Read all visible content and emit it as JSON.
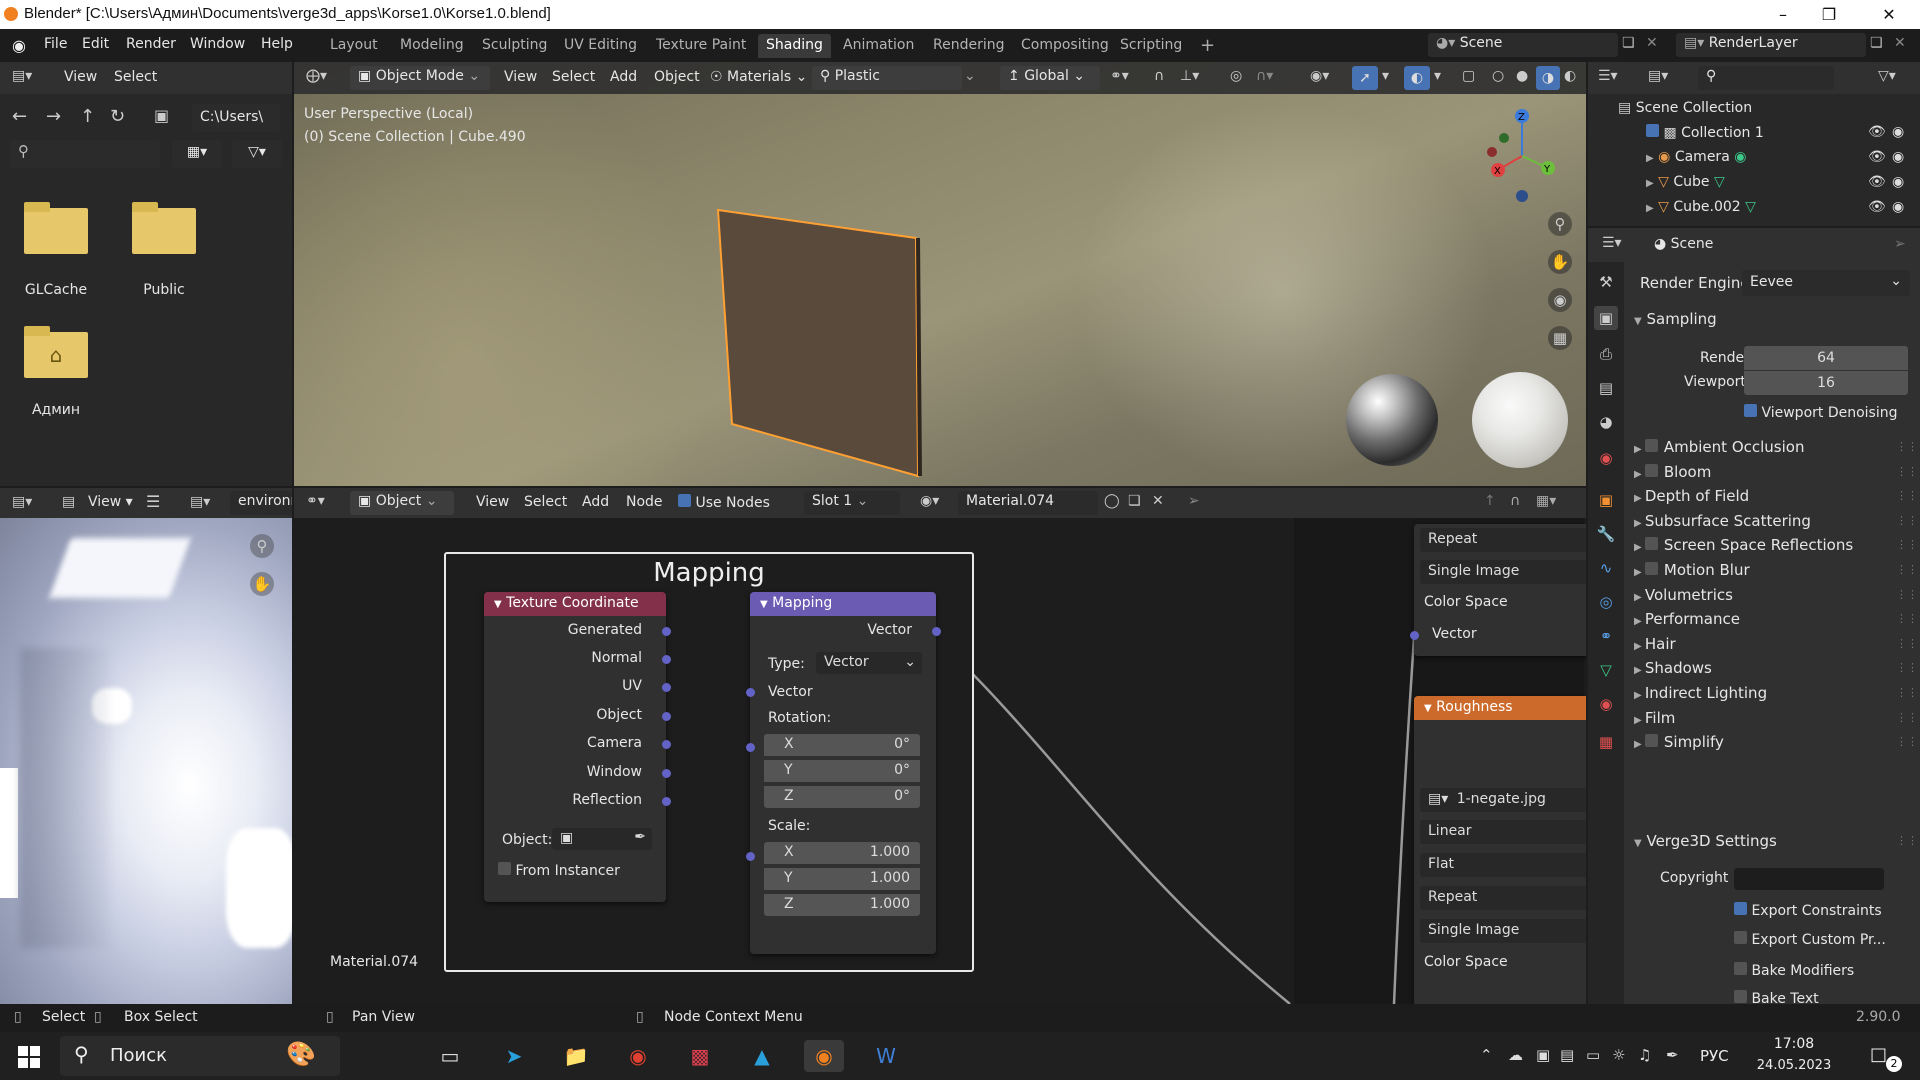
{
  "window": {
    "title": "Blender* [C:\\Users\\Админ\\Documents\\verge3d_apps\\Korse1.0\\Korse1.0.blend]"
  },
  "menu": [
    "File",
    "Edit",
    "Render",
    "Window",
    "Help"
  ],
  "workspaces": [
    "Layout",
    "Modeling",
    "Sculpting",
    "UV Editing",
    "Texture Paint",
    "Shading",
    "Animation",
    "Rendering",
    "Compositing",
    "Scripting"
  ],
  "active_workspace": "Shading",
  "scene": {
    "label": "Scene",
    "view_layer": "RenderLayer"
  },
  "filebrowser": {
    "menu": [
      "View",
      "Select"
    ],
    "path": "C:\\Users\\",
    "items": [
      {
        "label": "GLCache",
        "icon": "folder-icon"
      },
      {
        "label": "Public",
        "icon": "folder-icon"
      },
      {
        "label": "Админ",
        "icon": "home-folder-icon"
      }
    ]
  },
  "viewport": {
    "mode": "Object Mode",
    "menu": [
      "View",
      "Select",
      "Add",
      "Object"
    ],
    "materials": "Materials",
    "matcap": "Plastic",
    "orientation": "Global",
    "info_line1": "User Perspective (Local)",
    "info_line2": "(0) Scene Collection | Cube.490"
  },
  "image_editor": {
    "view": "View",
    "image": "environr"
  },
  "node_editor": {
    "type": "Object",
    "menu": [
      "View",
      "Select",
      "Add",
      "Node"
    ],
    "use_nodes": "Use Nodes",
    "slot": "Slot 1",
    "material": "Material.074",
    "frame_label": "Mapping",
    "material_label": "Material.074",
    "texcoord": {
      "title": "Texture Coordinate",
      "outputs": [
        "Generated",
        "Normal",
        "UV",
        "Object",
        "Camera",
        "Window",
        "Reflection"
      ],
      "object_label": "Object:",
      "from_instancer": "From Instancer"
    },
    "mapping": {
      "title": "Mapping",
      "output": "Vector",
      "type_label": "Type:",
      "type_value": "Vector",
      "vector_in": "Vector",
      "rotation_label": "Rotation:",
      "rotation": [
        {
          "axis": "X",
          "value": "0°"
        },
        {
          "axis": "Y",
          "value": "0°"
        },
        {
          "axis": "Z",
          "value": "0°"
        }
      ],
      "scale_label": "Scale:",
      "scale": [
        {
          "axis": "X",
          "value": "1.000"
        },
        {
          "axis": "Y",
          "value": "1.000"
        },
        {
          "axis": "Z",
          "value": "1.000"
        }
      ]
    },
    "right_node_top": [
      "Repeat",
      "Single Image",
      "Color Space",
      "Vector"
    ],
    "roughness": {
      "title": "Roughness",
      "image": "1-negate.jpg",
      "fields": [
        "Linear",
        "Flat",
        "Repeat",
        "Single Image",
        "Color Space"
      ]
    }
  },
  "outliner": {
    "root": "Scene Collection",
    "items": [
      {
        "label": "Collection 1",
        "icon": "collection-icon"
      },
      {
        "label": "Camera",
        "icon": "camera-icon"
      },
      {
        "label": "Cube",
        "icon": "mesh-icon"
      },
      {
        "label": "Cube.002",
        "icon": "mesh-icon"
      }
    ]
  },
  "properties": {
    "context": "Scene",
    "render_engine_label": "Render Engine",
    "render_engine": "Eevee",
    "sampling": {
      "title": "Sampling",
      "render_label": "Render",
      "render": "64",
      "viewport_label": "Viewport",
      "viewport": "16",
      "denoise": "Viewport Denoising"
    },
    "panels": [
      {
        "label": "Ambient Occlusion",
        "checkbox": true
      },
      {
        "label": "Bloom",
        "checkbox": true
      },
      {
        "label": "Depth of Field",
        "checkbox": false
      },
      {
        "label": "Subsurface Scattering",
        "checkbox": false
      },
      {
        "label": "Screen Space Reflections",
        "checkbox": true
      },
      {
        "label": "Motion Blur",
        "checkbox": true
      },
      {
        "label": "Volumetrics",
        "checkbox": false
      },
      {
        "label": "Performance",
        "checkbox": false
      },
      {
        "label": "Hair",
        "checkbox": false
      },
      {
        "label": "Shadows",
        "checkbox": false
      },
      {
        "label": "Indirect Lighting",
        "checkbox": false
      },
      {
        "label": "Film",
        "checkbox": false
      },
      {
        "label": "Simplify",
        "checkbox": true
      }
    ],
    "verge3d": {
      "title": "Verge3D Settings",
      "copyright_label": "Copyright",
      "export_constraints": "Export Constraints",
      "export_custom": "Export Custom Pr...",
      "bake_modifiers": "Bake Modifiers",
      "bake_text": "Bake Text"
    }
  },
  "statusbar": {
    "select": "Select",
    "box_select": "Box Select",
    "pan_view": "Pan View",
    "context_menu": "Node Context Menu",
    "version": "2.90.0"
  },
  "taskbar": {
    "search": "Поиск",
    "lang": "РУС",
    "time": "17:08",
    "date": "24.05.2023",
    "notifications": "2"
  },
  "colors": {
    "texcoord_header": "#83314a",
    "mapping_header": "#6c5bb3",
    "roughness_header": "#cc6a2c",
    "accent": "#4772b3"
  }
}
